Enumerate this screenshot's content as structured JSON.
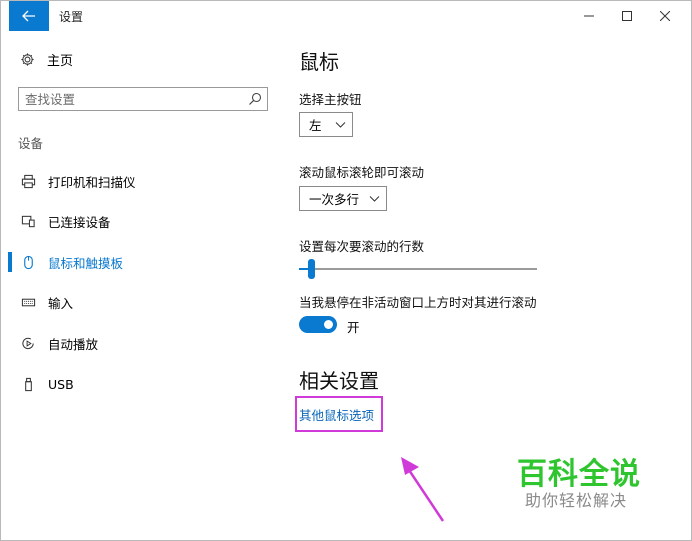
{
  "window": {
    "title": "设置"
  },
  "sidebar": {
    "home_label": "主页",
    "search_placeholder": "查找设置",
    "section_label": "设备",
    "items": [
      {
        "label": "打印机和扫描仪",
        "icon": "printer-icon"
      },
      {
        "label": "已连接设备",
        "icon": "connected-devices-icon"
      },
      {
        "label": "鼠标和触摸板",
        "icon": "mouse-icon",
        "selected": true
      },
      {
        "label": "输入",
        "icon": "keyboard-icon"
      },
      {
        "label": "自动播放",
        "icon": "autoplay-icon"
      },
      {
        "label": "USB",
        "icon": "usb-icon"
      }
    ]
  },
  "content": {
    "title": "鼠标",
    "primary_button": {
      "label": "选择主按钮",
      "value": "左"
    },
    "scroll_wheel": {
      "label": "滚动鼠标滚轮即可滚动",
      "value": "一次多行"
    },
    "lines_to_scroll": {
      "label": "设置每次要滚动的行数"
    },
    "inactive_scroll": {
      "label": "当我悬停在非活动窗口上方时对其进行滚动",
      "state_text": "开",
      "on": true
    },
    "related_title": "相关设置",
    "related_link": "其他鼠标选项"
  },
  "watermark": {
    "brand": "百科全说",
    "tagline": "助你轻松解决"
  },
  "colors": {
    "accent": "#0a79d0",
    "highlight_box": "#d03ad8",
    "brand_green": "#2fc52f",
    "link": "#0a66b8"
  }
}
